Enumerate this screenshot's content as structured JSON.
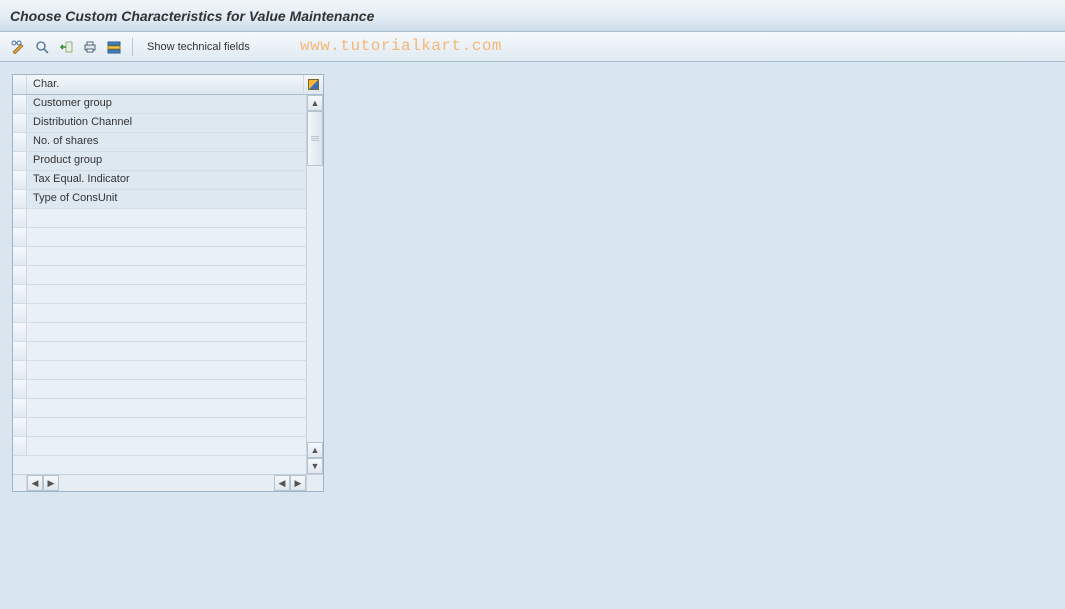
{
  "header": {
    "title": "Choose Custom Characteristics for Value Maintenance"
  },
  "toolbar": {
    "show_technical_fields": "Show technical fields"
  },
  "watermark": "www.tutorialkart.com",
  "grid": {
    "column_header": "Char.",
    "rows": [
      "Customer group",
      "Distribution Channel",
      "No. of shares",
      "Product group",
      "Tax Equal. Indicator",
      "Type of ConsUnit"
    ],
    "empty_row_count": 13
  }
}
